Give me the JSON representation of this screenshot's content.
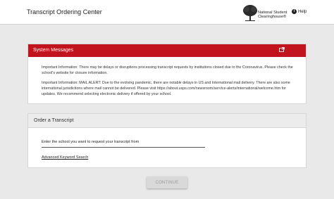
{
  "header": {
    "title": "Transcript Ordering Center",
    "logo_text_line1": "National Student",
    "logo_text_line2": "Clearinghouse",
    "help_label": "Help"
  },
  "system_messages": {
    "title": "System Messages",
    "message_1": "Important Information: There may be delays or disruptions processing transcript requests by institutions closed due to the Coronavirus. Please check the school's website for closure information.",
    "message_2": "Important Information: MAIL ALERT: Due to the evolving pandemic, there are notable delays in US and International mail delivery. There are also some international jurisdictions where mail cannot be delivered. Please visit https://about.usps.com/newsroom/service-alerts/international/welcome.htm for updates. We recommend selecting electronic delivery if offered by your school."
  },
  "order": {
    "title": "Order a Transcript",
    "school_label": "Enter the school you want to request your transcript from",
    "school_value": "",
    "advanced_search_label": "Advanced Keyword Search"
  },
  "actions": {
    "continue_label": "CONTINUE"
  },
  "colors": {
    "accent_red": "#c1141e",
    "background": "#e9e9e9",
    "disabled_button": "#d9d9d9"
  },
  "icons": {
    "logo": "tree-icon",
    "help": "help-icon",
    "messages": "external-window-icon"
  }
}
